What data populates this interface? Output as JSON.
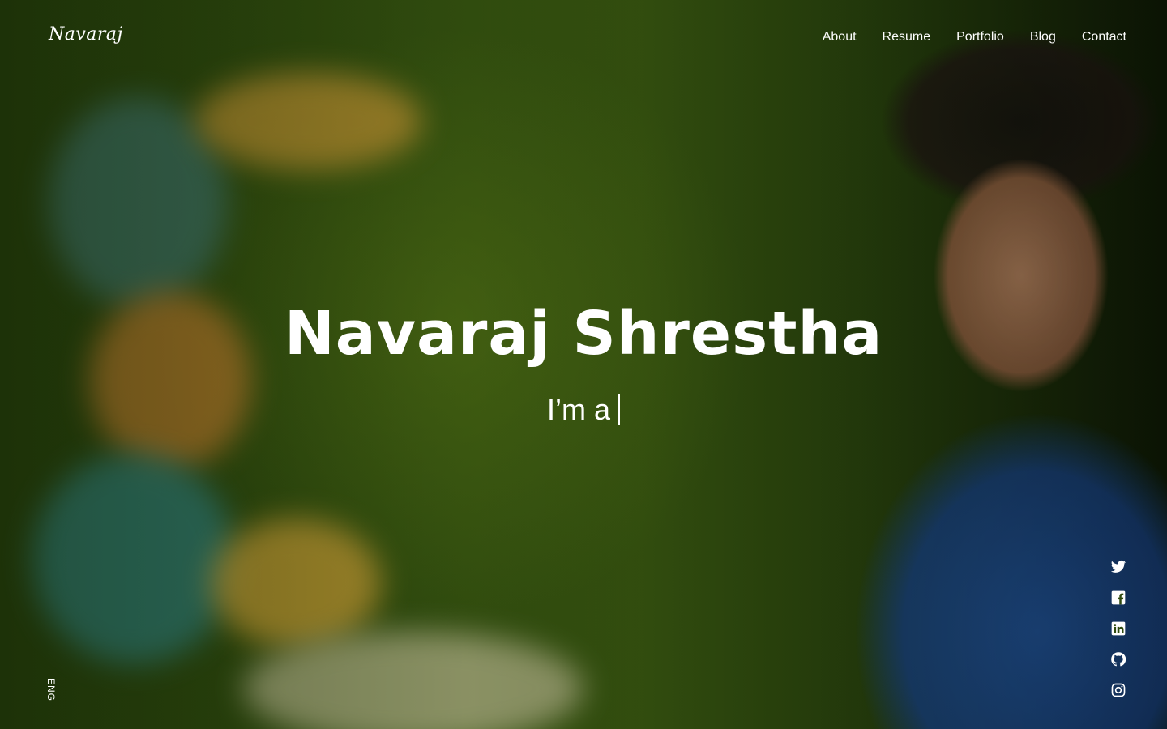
{
  "header": {
    "logo_text": "Navaraj",
    "nav": [
      {
        "label": "About"
      },
      {
        "label": "Resume"
      },
      {
        "label": "Portfolio"
      },
      {
        "label": "Blog"
      },
      {
        "label": "Contact"
      }
    ]
  },
  "hero": {
    "name": "Navaraj Shrestha",
    "tagline": "I’m a"
  },
  "language": {
    "label": "ENG"
  },
  "social": [
    {
      "icon": "twitter-icon"
    },
    {
      "icon": "facebook-icon"
    },
    {
      "icon": "linkedin-icon"
    },
    {
      "icon": "github-icon"
    },
    {
      "icon": "instagram-icon"
    }
  ],
  "colors": {
    "background": "#2f4a0e",
    "text": "#ffffff"
  }
}
